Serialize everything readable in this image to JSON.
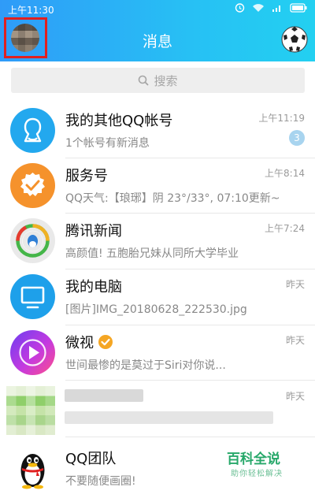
{
  "status_bar": {
    "time": "上午11:30"
  },
  "header": {
    "title": "消息"
  },
  "search": {
    "placeholder": "搜索"
  },
  "conversations": [
    {
      "name": "我的其他QQ帐号",
      "preview": "1个帐号有新消息",
      "time": "上午11:19",
      "badge": "3"
    },
    {
      "name": "服务号",
      "preview": "QQ天气:【琅琊】阴 23°/33°, 07:10更新~",
      "time": "上午8:14"
    },
    {
      "name": "腾讯新闻",
      "preview": "高颜值! 五胞胎兄妹从同所大学毕业",
      "time": "上午7:24"
    },
    {
      "name": "我的电脑",
      "preview": "[图片]IMG_20180628_222530.jpg",
      "time": "昨天"
    },
    {
      "name": "微视",
      "preview": "世间最惨的是莫过于Siri对你说...",
      "time": "昨天"
    },
    {
      "name": "",
      "preview": "",
      "time": "昨天"
    },
    {
      "name": "QQ团队",
      "preview": "不要随便画圈!",
      "time": ""
    }
  ],
  "watermark": {
    "main": "百科全说",
    "sub": "助你轻松解决"
  },
  "colors": {
    "header_start": "#2f9bf8",
    "header_end": "#23d0f1",
    "badge": "#a8d4ef",
    "watermark": "#27a86a"
  },
  "icons": [
    "avatar",
    "football-icon",
    "search-icon",
    "contacts-icon",
    "service-badge-icon",
    "tencent-news-icon",
    "computer-icon",
    "weishi-icon",
    "verified-icon",
    "qq-penguin-icon"
  ]
}
